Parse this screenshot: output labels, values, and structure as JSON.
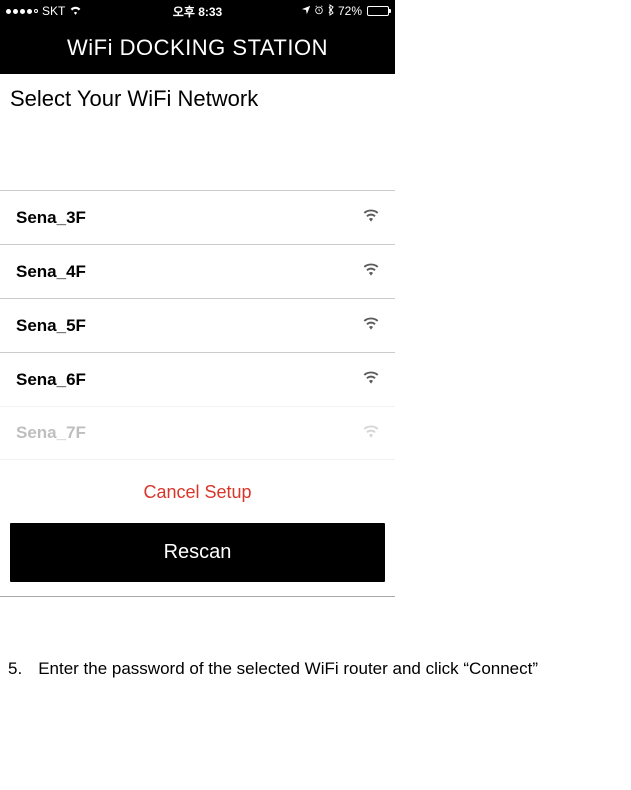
{
  "status_bar": {
    "carrier": "SKT",
    "time": "오후 8:33",
    "battery_pct": "72%"
  },
  "nav": {
    "title": "WiFi DOCKING STATION"
  },
  "heading": "Select Your WiFi Network",
  "networks": [
    {
      "ssid": "Sena_3F"
    },
    {
      "ssid": "Sena_4F"
    },
    {
      "ssid": "Sena_5F"
    },
    {
      "ssid": "Sena_6F"
    },
    {
      "ssid": "Sena_7F"
    }
  ],
  "cancel_label": "Cancel Setup",
  "rescan_label": "Rescan",
  "instruction": {
    "number": "5.",
    "text": "Enter the password of the selected WiFi router and click “Connect”"
  }
}
